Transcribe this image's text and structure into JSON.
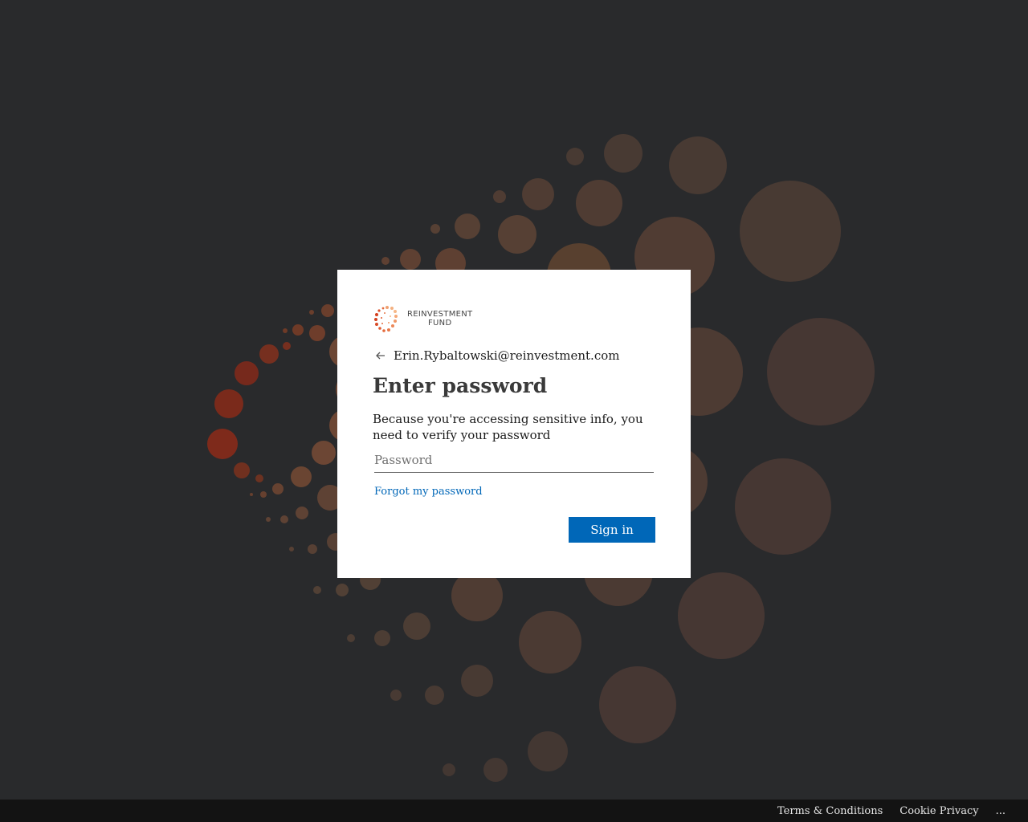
{
  "brand": {
    "logo_line1": "REINVESTMENT",
    "logo_line2": "FUND",
    "accent": "#e0592a"
  },
  "identity": {
    "back_icon": "arrow-left-icon",
    "email": "Erin.Rybaltowski@reinvestment.com"
  },
  "form": {
    "title": "Enter password",
    "description": "Because you're accessing sensitive info, you need to verify your password",
    "password_placeholder": "Password",
    "password_value": "",
    "forgot_link": "Forgot my password",
    "submit_label": "Sign in",
    "submit_color": "#0067b8"
  },
  "footer": {
    "terms": "Terms & Conditions",
    "cookie": "Cookie Privacy",
    "more": "..."
  },
  "colors": {
    "background": "#292a2c",
    "footer_bg": "#131313",
    "link": "#0067b8"
  }
}
